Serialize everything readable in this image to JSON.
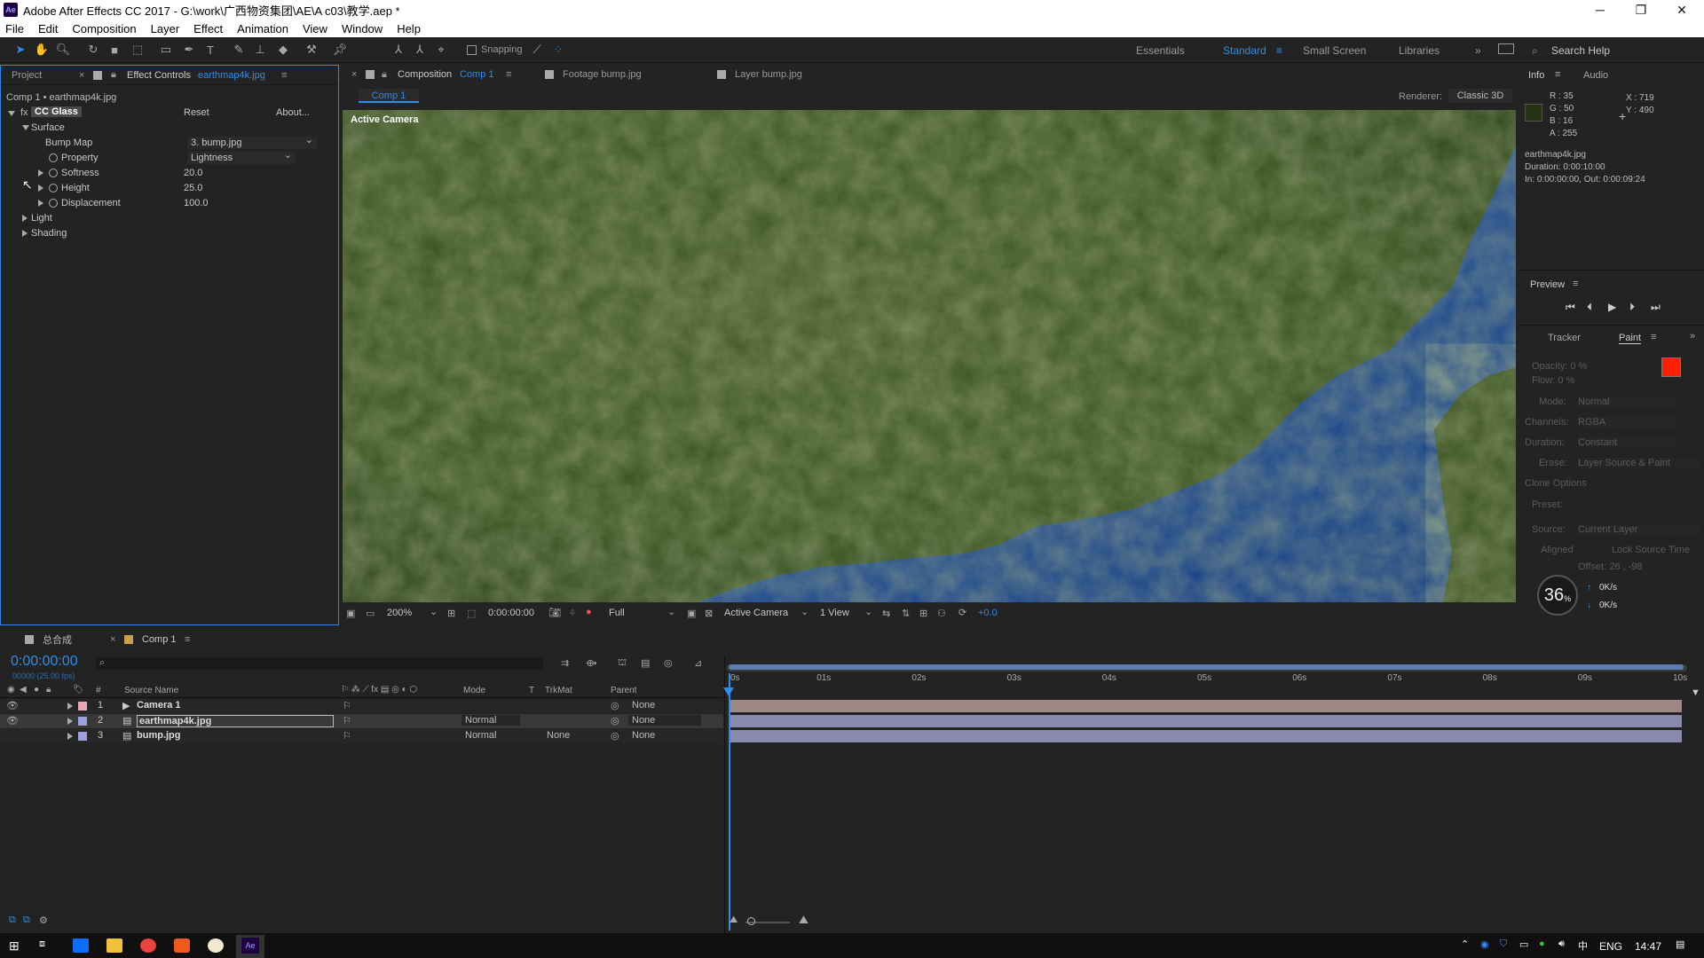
{
  "window": {
    "title": "Adobe After Effects CC 2017 - G:\\work\\广西物资集团\\AE\\A c03\\教学.aep *",
    "app_icon": "Ae",
    "min": "─",
    "max": "❐",
    "close": "✕"
  },
  "menu": [
    "File",
    "Edit",
    "Composition",
    "Layer",
    "Effect",
    "Animation",
    "View",
    "Window",
    "Help"
  ],
  "toolbar": {
    "snapping_label": "Snapping",
    "workspaces": [
      "Essentials",
      "Standard",
      "Small Screen",
      "Libraries"
    ],
    "active_workspace": "Standard",
    "search_help": "Search Help"
  },
  "left_panel": {
    "tab_project": "Project",
    "tab_effect_controls": "Effect Controls",
    "effect_controls_layer": "earthmap4k.jpg",
    "breadcrumb": "Comp 1 • earthmap4k.jpg",
    "effect_name": "CC Glass",
    "reset": "Reset",
    "about": "About...",
    "surface": "Surface",
    "bump_map_label": "Bump Map",
    "bump_map_value": "3. bump.jpg",
    "property_label": "Property",
    "property_value": "Lightness",
    "softness_label": "Softness",
    "softness_value": "20.0",
    "height_label": "Height",
    "height_value": "25.0",
    "displacement_label": "Displacement",
    "displacement_value": "100.0",
    "light": "Light",
    "shading": "Shading"
  },
  "center_panel": {
    "tab_composition_prefix": "Composition",
    "tab_composition_name": "Comp 1",
    "tab_footage": "Footage bump.jpg",
    "tab_layer": "Layer bump.jpg",
    "comp_chip": "Comp 1",
    "renderer_label": "Renderer:",
    "renderer_value": "Classic 3D",
    "active_camera_overlay": "Active Camera",
    "viewer_bar": {
      "zoom": "200%",
      "timecode": "0:00:00:00",
      "resolution": "Full",
      "camera": "Active Camera",
      "views": "1 View",
      "exposure": "+0.0"
    }
  },
  "info_panel": {
    "tab_info": "Info",
    "tab_audio": "Audio",
    "r": "R : 35",
    "g": "G : 50",
    "b": "B : 16",
    "a": "A : 255",
    "x": "X : 719",
    "y": "Y : 490",
    "swatch_color": "#233210",
    "file": "earthmap4k.jpg",
    "duration": "Duration: 0:00:10:00",
    "in_out": "In: 0:00:00:00, Out: 0:00:09:24"
  },
  "preview_panel": {
    "title": "Preview"
  },
  "paint_panel": {
    "tab_tracker": "Tracker",
    "tab_paint": "Paint",
    "opacity": "Opacity: 0 %",
    "flow": "Flow: 0 %",
    "mode_label": "Mode:",
    "mode_value": "Normal",
    "channels_label": "Channels:",
    "channels_value": "RGBA",
    "duration_label": "Duration:",
    "duration_value": "Constant",
    "erase_label": "Erase:",
    "erase_value": "Layer Source & Paint",
    "clone_options": "Clone Options",
    "preset_label": "Preset:",
    "source_label": "Source:",
    "source_value": "Current Layer",
    "aligned": "Aligned",
    "lock_source_time": "Lock Source Time",
    "offset": "Offset: 26 , -98",
    "foreground_color": "#ff2000",
    "background_color": "#ffffff",
    "overlay_percent": "36",
    "overlay_percent_unit": "%",
    "net_up": "0K/s",
    "net_down": "0K/s"
  },
  "timeline": {
    "tab_1": "总合成",
    "tab_2": "Comp 1",
    "timecode": "0:00:00:00",
    "fps": "00000 (25.00 fps)",
    "columns": {
      "num": "#",
      "source_name": "Source Name",
      "mode": "Mode",
      "t": "T",
      "trkmat": "TrkMat",
      "parent": "Parent"
    },
    "ruler": [
      "0s",
      "01s",
      "02s",
      "03s",
      "04s",
      "05s",
      "06s",
      "07s",
      "08s",
      "09s",
      "10s"
    ],
    "layers": [
      {
        "num": "1",
        "name": "Camera 1",
        "label_color": "#e5a8b4",
        "mode": "",
        "trkmat": "",
        "parent": "None",
        "bar_color": "#b49a98"
      },
      {
        "num": "2",
        "name": "earthmap4k.jpg",
        "label_color": "#9aa0d8",
        "mode": "Normal",
        "trkmat": "",
        "parent": "None",
        "bar_color": "#9c9cc8"
      },
      {
        "num": "3",
        "name": "bump.jpg",
        "label_color": "#9aa0d8",
        "mode": "Normal",
        "trkmat": "None",
        "parent": "None",
        "bar_color": "#9c9cc8"
      }
    ]
  },
  "taskbar": {
    "lang": "ENG",
    "time": "14:47"
  }
}
